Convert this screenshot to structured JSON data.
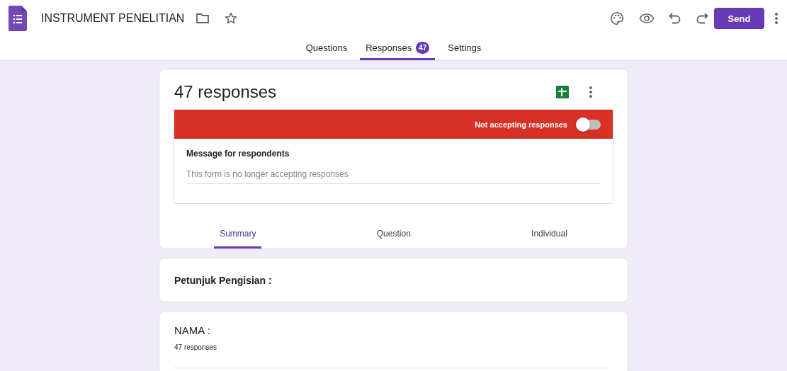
{
  "header": {
    "title": "INSTRUMENT PENELITIAN",
    "send_button": "Send"
  },
  "tabs": [
    {
      "label": "Questions",
      "selected": false
    },
    {
      "label": "Responses",
      "selected": true,
      "badge": "47"
    },
    {
      "label": "Settings",
      "selected": false
    }
  ],
  "responses_card": {
    "title": "47 responses",
    "accepting": {
      "label": "Not accepting responses",
      "on": false
    },
    "message_label": "Message for respondents",
    "message": "This form is no longer accepting responses",
    "view_tabs": [
      {
        "label": "Summary",
        "selected": true
      },
      {
        "label": "Question",
        "selected": false
      },
      {
        "label": "Individual",
        "selected": false
      }
    ]
  },
  "items": [
    {
      "kind": "section",
      "title": "Petunjuk Pengisian :"
    },
    {
      "kind": "question",
      "title": "NAMA :",
      "count": "47 responses"
    }
  ]
}
